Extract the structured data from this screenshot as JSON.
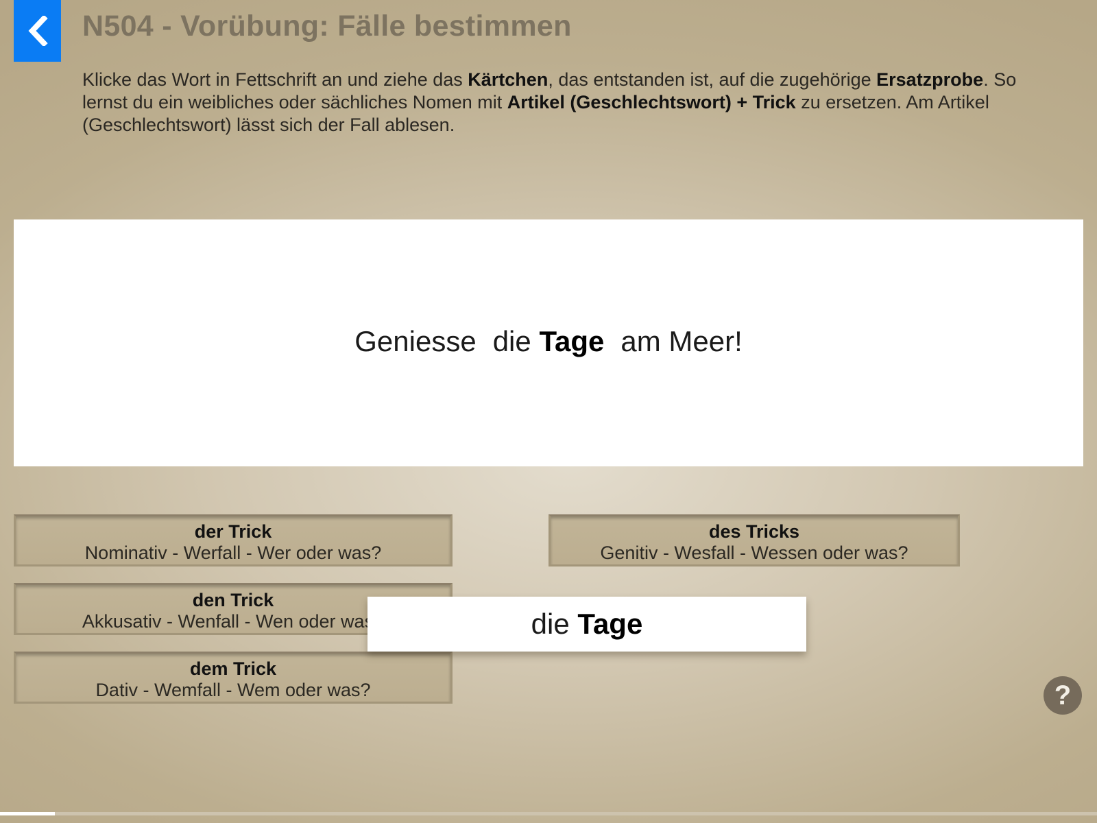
{
  "header": {
    "back_icon": "chevron-left-icon",
    "title": "N504 - Vorübung: Fälle bestimmen"
  },
  "instructions": {
    "t1": "Klicke das Wort in Fettschrift an und ziehe das ",
    "b1": "Kärtchen",
    "t2": ", das entstanden ist, auf die zugehörige ",
    "b2": "Ersatzprobe",
    "t3": ". So lernst du ein weibliches oder sächliches Nomen mit ",
    "b3": "Artikel (Geschlechtswort) + Trick",
    "t4": " zu ersetzen. Am Artikel (Geschlechtswort) lässt sich der Fall ablesen."
  },
  "sentence": {
    "part1": "Geniesse",
    "article": "die",
    "noun": "Tage",
    "part3": "am Meer!"
  },
  "drop_zones": [
    {
      "article": "der Trick",
      "description": "Nominativ - Werfall - Wer oder was?"
    },
    {
      "article": "des Tricks",
      "description": "Genitiv - Wesfall - Wessen oder was?"
    },
    {
      "article": "den Trick",
      "description": "Akkusativ - Wenfall - Wen oder was?"
    },
    {
      "article": "dem Trick",
      "description": "Dativ - Wemfall - Wem oder was?"
    }
  ],
  "drag_card": {
    "article": "die",
    "noun": "Tage"
  },
  "help": {
    "icon": "question-mark-icon",
    "label": "?"
  },
  "progress": {
    "fraction": 0.05
  },
  "colors": {
    "accent": "#0a7cf4",
    "title": "#7d7360",
    "help_bg": "#766b5b"
  }
}
